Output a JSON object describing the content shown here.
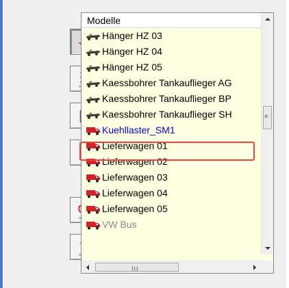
{
  "list": {
    "header": "Modelle",
    "items": [
      {
        "label": "Hänger HZ 03",
        "icon": "flatcar-icon"
      },
      {
        "label": "Hänger HZ 04",
        "icon": "flatcar-icon"
      },
      {
        "label": "Hänger HZ 05",
        "icon": "flatcar-icon"
      },
      {
        "label": "Kaessbohrer Tankauflieger AG",
        "icon": "flatcar-icon"
      },
      {
        "label": "Kaessbohrer Tankauflieger BP",
        "icon": "flatcar-icon"
      },
      {
        "label": "Kaessbohrer Tankauflieger SH",
        "icon": "flatcar-icon"
      },
      {
        "label": "Kuehllaster_SM1",
        "icon": "truck-icon",
        "selected": true
      },
      {
        "label": "Lieferwagen 01",
        "icon": "truck-icon"
      },
      {
        "label": "Lieferwagen 02",
        "icon": "truck-icon"
      },
      {
        "label": "Lieferwagen 03",
        "icon": "truck-icon"
      },
      {
        "label": "Lieferwagen 04",
        "icon": "truck-icon"
      },
      {
        "label": "Lieferwagen 05",
        "icon": "truck-icon"
      }
    ],
    "partially_visible_item": "VW Bus"
  },
  "toolbar": {
    "buttons": [
      {
        "name": "place-objects-button",
        "icon": "landscape-place-icon",
        "pressed": true
      },
      {
        "name": "track-editor-button",
        "icon": "rails-locomotive-icon",
        "pressed": false
      },
      {
        "name": "camera-button",
        "icon": "camera-icon",
        "pressed": false
      },
      {
        "name": "terrain-button",
        "icon": "terrain-icon",
        "pressed": false
      },
      {
        "name": "train-reverse-button",
        "icon": "train-reverse-icon",
        "pressed": false
      },
      {
        "name": "train-up-button",
        "icon": "train-up-icon",
        "pressed": false
      }
    ]
  },
  "scrollbar": {
    "horizontal_grip": "III",
    "vertical_grip": "≡"
  },
  "colors": {
    "highlight": "#e8453c",
    "list_background": "#ffffe1",
    "selected_text": "#0000ee"
  }
}
